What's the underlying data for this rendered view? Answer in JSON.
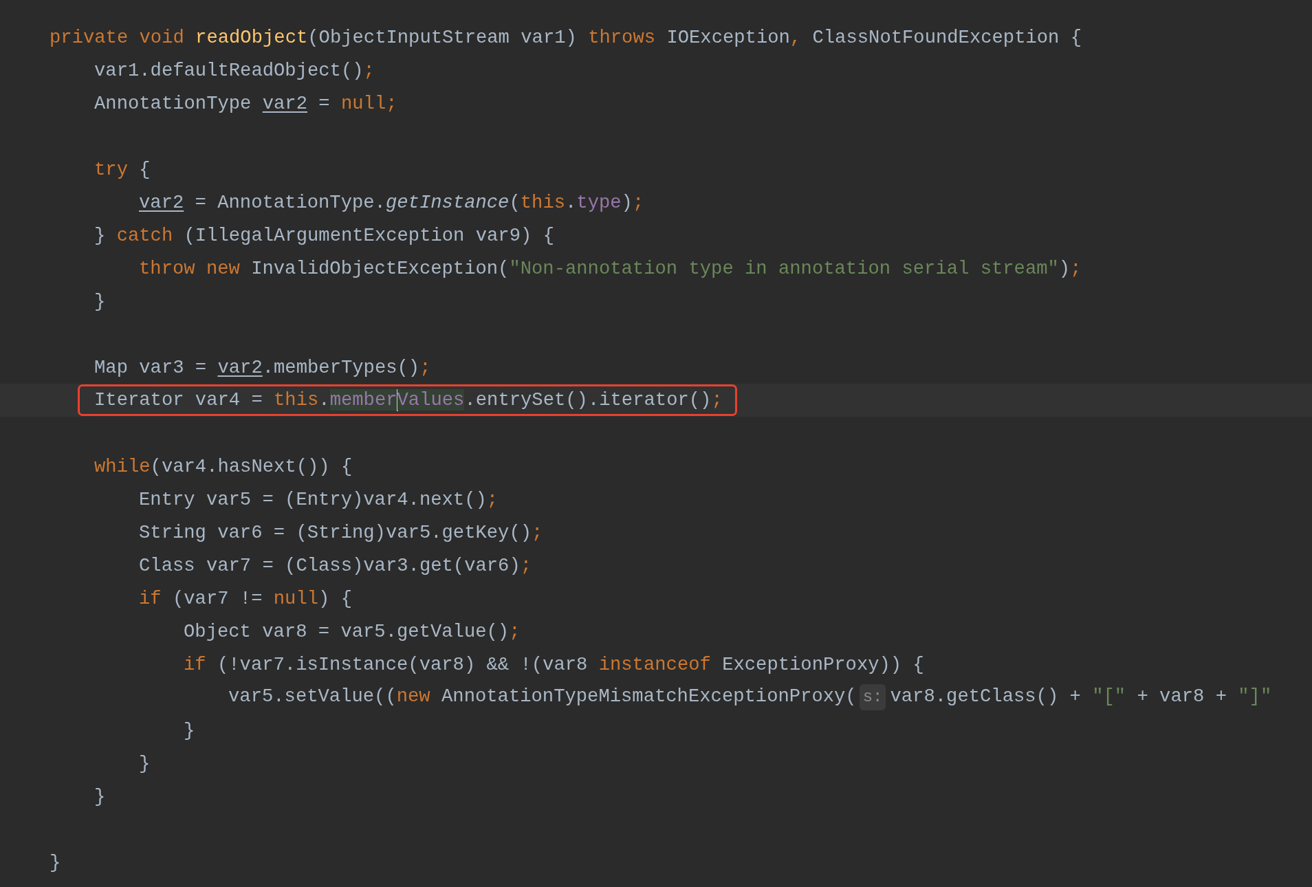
{
  "lines": [
    {
      "kind": "code",
      "tokens": [
        {
          "kind": "keyword",
          "text": "private void "
        },
        {
          "kind": "method",
          "text": "readObject"
        },
        {
          "kind": "plain",
          "text": "(ObjectInputStream var1) "
        },
        {
          "kind": "keyword",
          "text": "throws "
        },
        {
          "kind": "plain",
          "text": "IOException"
        },
        {
          "kind": "keyword",
          "text": ", "
        },
        {
          "kind": "plain",
          "text": "ClassNotFoundException {"
        }
      ],
      "children": [
        {
          "kind": "code",
          "tokens": [
            {
              "kind": "plain",
              "text": "var1.defaultReadObject()"
            },
            {
              "kind": "keyword",
              "text": ";"
            }
          ]
        },
        {
          "kind": "code",
          "tokens": [
            {
              "kind": "plain",
              "text": "AnnotationType "
            },
            {
              "kind": "underlined",
              "text": "var2"
            },
            {
              "kind": "plain",
              "text": " = "
            },
            {
              "kind": "keyword",
              "text": "null;"
            }
          ]
        },
        {
          "kind": "blank"
        },
        {
          "kind": "code",
          "tokens": [
            {
              "kind": "keyword",
              "text": "try "
            },
            {
              "kind": "plain",
              "text": "{"
            }
          ],
          "children": [
            {
              "kind": "code",
              "tokens": [
                {
                  "kind": "underlined",
                  "text": "var2"
                },
                {
                  "kind": "plain",
                  "text": " = AnnotationType."
                },
                {
                  "kind": "italic",
                  "text": "getInstance"
                },
                {
                  "kind": "plain",
                  "text": "("
                },
                {
                  "kind": "keyword",
                  "text": "this"
                },
                {
                  "kind": "plain",
                  "text": "."
                },
                {
                  "kind": "field",
                  "text": "type"
                },
                {
                  "kind": "plain",
                  "text": ")"
                },
                {
                  "kind": "keyword",
                  "text": ";"
                }
              ]
            }
          ]
        },
        {
          "kind": "code",
          "tokens": [
            {
              "kind": "plain",
              "text": "} "
            },
            {
              "kind": "keyword",
              "text": "catch "
            },
            {
              "kind": "plain",
              "text": "(IllegalArgumentException var9) {"
            }
          ],
          "children": [
            {
              "kind": "code",
              "tokens": [
                {
                  "kind": "keyword",
                  "text": "throw new "
                },
                {
                  "kind": "plain",
                  "text": "InvalidObjectException("
                },
                {
                  "kind": "string",
                  "text": "\"Non-annotation type in annotation serial stream\""
                },
                {
                  "kind": "plain",
                  "text": ")"
                },
                {
                  "kind": "keyword",
                  "text": ";"
                }
              ]
            }
          ]
        },
        {
          "kind": "code",
          "tokens": [
            {
              "kind": "plain",
              "text": "}"
            }
          ]
        },
        {
          "kind": "blank"
        },
        {
          "kind": "code",
          "tokens": [
            {
              "kind": "plain",
              "text": "Map var3 = "
            },
            {
              "kind": "underlined",
              "text": "var2"
            },
            {
              "kind": "plain",
              "text": ".memberTypes()"
            },
            {
              "kind": "keyword",
              "text": ";"
            }
          ]
        },
        {
          "kind": "code",
          "current": true,
          "boxed": true,
          "tokens": [
            {
              "kind": "plain",
              "text": "Iterator var4 = "
            },
            {
              "kind": "keyword",
              "text": "this"
            },
            {
              "kind": "plain",
              "text": "."
            },
            {
              "kind": "field",
              "text": "member",
              "occurrence": true
            },
            {
              "kind": "caret"
            },
            {
              "kind": "field",
              "text": "Values",
              "occurrence": true
            },
            {
              "kind": "plain",
              "text": ".entrySet().iterator()"
            },
            {
              "kind": "keyword",
              "text": ";"
            }
          ]
        },
        {
          "kind": "blank"
        },
        {
          "kind": "code",
          "tokens": [
            {
              "kind": "keyword",
              "text": "while"
            },
            {
              "kind": "plain",
              "text": "(var4.hasNext()) {"
            }
          ],
          "children": [
            {
              "kind": "code",
              "tokens": [
                {
                  "kind": "plain",
                  "text": "Entry var5 = (Entry)var4.next()"
                },
                {
                  "kind": "keyword",
                  "text": ";"
                }
              ]
            },
            {
              "kind": "code",
              "tokens": [
                {
                  "kind": "plain",
                  "text": "String var6 = (String)var5.getKey()"
                },
                {
                  "kind": "keyword",
                  "text": ";"
                }
              ]
            },
            {
              "kind": "code",
              "tokens": [
                {
                  "kind": "plain",
                  "text": "Class var7 = (Class)var3.get(var6)"
                },
                {
                  "kind": "keyword",
                  "text": ";"
                }
              ]
            },
            {
              "kind": "code",
              "tokens": [
                {
                  "kind": "keyword",
                  "text": "if "
                },
                {
                  "kind": "plain",
                  "text": "(var7 != "
                },
                {
                  "kind": "keyword",
                  "text": "null"
                },
                {
                  "kind": "plain",
                  "text": ") {"
                }
              ],
              "children": [
                {
                  "kind": "code",
                  "tokens": [
                    {
                      "kind": "plain",
                      "text": "Object var8 = var5.getValue()"
                    },
                    {
                      "kind": "keyword",
                      "text": ";"
                    }
                  ]
                },
                {
                  "kind": "code",
                  "tokens": [
                    {
                      "kind": "keyword",
                      "text": "if "
                    },
                    {
                      "kind": "plain",
                      "text": "(!var7.isInstance(var8) && !(var8 "
                    },
                    {
                      "kind": "keyword",
                      "text": "instanceof "
                    },
                    {
                      "kind": "plain",
                      "text": "ExceptionProxy)) {"
                    }
                  ],
                  "children": [
                    {
                      "kind": "code",
                      "tokens": [
                        {
                          "kind": "plain",
                          "text": "var5.setValue(("
                        },
                        {
                          "kind": "keyword",
                          "text": "new "
                        },
                        {
                          "kind": "plain",
                          "text": "AnnotationTypeMismatchExceptionProxy("
                        },
                        {
                          "kind": "hint",
                          "text": "s:"
                        },
                        {
                          "kind": "plain",
                          "text": "var8.getClass() + "
                        },
                        {
                          "kind": "string",
                          "text": "\"[\""
                        },
                        {
                          "kind": "plain",
                          "text": " + var8 + "
                        },
                        {
                          "kind": "string",
                          "text": "\"]\""
                        }
                      ]
                    }
                  ]
                },
                {
                  "kind": "code",
                  "tokens": [
                    {
                      "kind": "plain",
                      "text": "}"
                    }
                  ]
                }
              ]
            },
            {
              "kind": "code",
              "tokens": [
                {
                  "kind": "plain",
                  "text": "}"
                }
              ]
            }
          ]
        },
        {
          "kind": "code",
          "tokens": [
            {
              "kind": "plain",
              "text": "}"
            }
          ]
        }
      ]
    },
    {
      "kind": "blank"
    },
    {
      "kind": "code",
      "tokens": [
        {
          "kind": "plain",
          "text": "}"
        }
      ]
    }
  ]
}
